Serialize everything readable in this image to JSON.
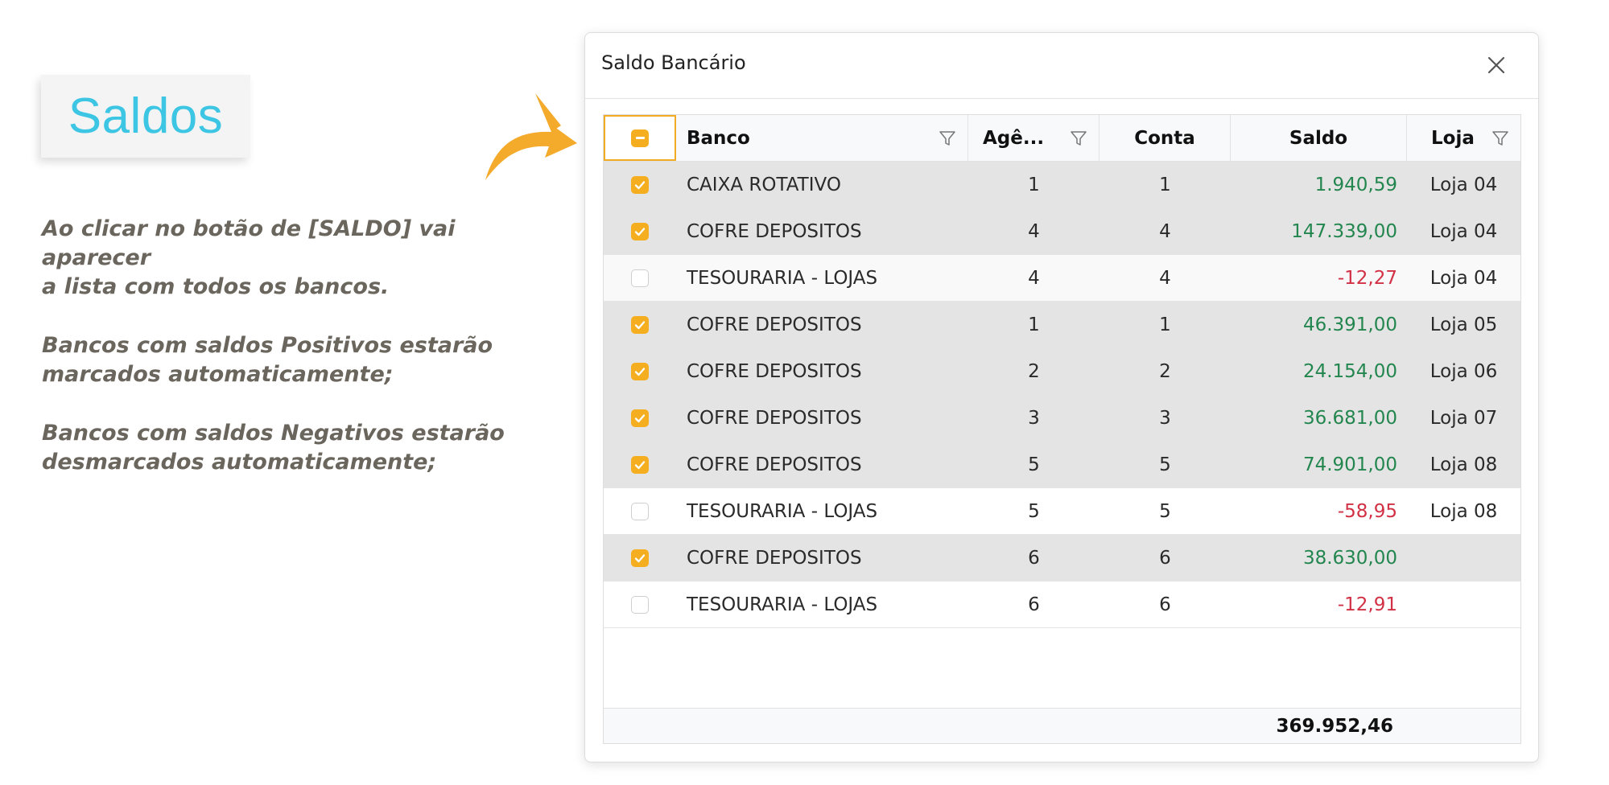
{
  "annotation": {
    "title": "Saldos",
    "notes": [
      "Ao clicar no botão de [SALDO] vai aparecer\na lista com todos os bancos.",
      "Bancos com saldos Positivos estarão\nmarcados automaticamente;",
      "Bancos com saldos Negativos estarão\ndesmarcados automaticamente;"
    ]
  },
  "dialog": {
    "title": "Saldo Bancário",
    "columns": {
      "banco": "Banco",
      "agencia": "Agê...",
      "conta": "Conta",
      "saldo": "Saldo",
      "loja": "Loja"
    },
    "rows": [
      {
        "checked": true,
        "banco": "CAIXA ROTATIVO",
        "agencia": "1",
        "conta": "1",
        "saldo": "1.940,59",
        "loja": "Loja 04",
        "sign": "pos"
      },
      {
        "checked": true,
        "banco": "COFRE DEPOSITOS",
        "agencia": "4",
        "conta": "4",
        "saldo": "147.339,00",
        "loja": "Loja 04",
        "sign": "pos"
      },
      {
        "checked": false,
        "banco": "TESOURARIA - LOJAS",
        "agencia": "4",
        "conta": "4",
        "saldo": "-12,27",
        "loja": "Loja 04",
        "sign": "neg"
      },
      {
        "checked": true,
        "banco": "COFRE DEPOSITOS",
        "agencia": "1",
        "conta": "1",
        "saldo": "46.391,00",
        "loja": "Loja 05",
        "sign": "pos"
      },
      {
        "checked": true,
        "banco": "COFRE DEPOSITOS",
        "agencia": "2",
        "conta": "2",
        "saldo": "24.154,00",
        "loja": "Loja 06",
        "sign": "pos"
      },
      {
        "checked": true,
        "banco": "COFRE DEPOSITOS",
        "agencia": "3",
        "conta": "3",
        "saldo": "36.681,00",
        "loja": "Loja 07",
        "sign": "pos"
      },
      {
        "checked": true,
        "banco": "COFRE DEPOSITOS",
        "agencia": "5",
        "conta": "5",
        "saldo": "74.901,00",
        "loja": "Loja 08",
        "sign": "pos"
      },
      {
        "checked": false,
        "banco": "TESOURARIA - LOJAS",
        "agencia": "5",
        "conta": "5",
        "saldo": "-58,95",
        "loja": "Loja 08",
        "sign": "neg"
      },
      {
        "checked": true,
        "banco": "COFRE DEPOSITOS",
        "agencia": "6",
        "conta": "6",
        "saldo": "38.630,00",
        "loja": "",
        "sign": "pos"
      },
      {
        "checked": false,
        "banco": "TESOURARIA - LOJAS",
        "agencia": "6",
        "conta": "6",
        "saldo": "-12,91",
        "loja": "",
        "sign": "neg"
      }
    ],
    "total": "369.952,46"
  },
  "colors": {
    "accent": "#f5ae1f",
    "title_cyan": "#3cc6e4",
    "positive": "#23864f",
    "negative": "#d23145"
  },
  "icons": [
    "arrow-icon",
    "close-icon",
    "filter-icon",
    "checkbox-indeterminate-icon",
    "checkbox-checked-icon"
  ]
}
